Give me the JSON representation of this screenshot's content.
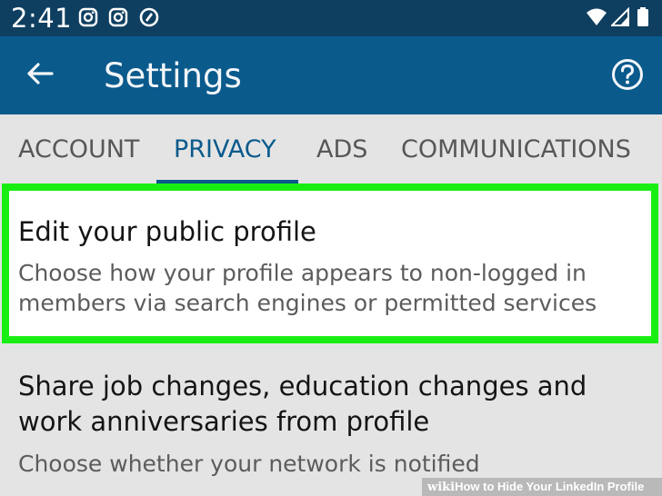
{
  "status_bar": {
    "time": "2:41",
    "left_icons": [
      "instagram-icon",
      "instagram-icon",
      "at-sign-icon"
    ],
    "right_icons": [
      "wifi-icon",
      "signal-icon",
      "battery-icon"
    ]
  },
  "app_bar": {
    "title": "Settings",
    "back_icon": "arrow-left-icon",
    "help_icon": "help-circle-icon"
  },
  "tabs": [
    {
      "label": "ACCOUNT",
      "active": false
    },
    {
      "label": "PRIVACY",
      "active": true
    },
    {
      "label": "ADS",
      "active": false
    },
    {
      "label": "COMMUNICATIONS",
      "active": false
    }
  ],
  "settings_items": [
    {
      "title": "Edit your public profile",
      "subtitle_lines": [
        "Choose how your profile appears to non-logged in",
        "members via search engines or permitted services"
      ],
      "highlighted": true
    },
    {
      "title_lines": [
        "Share job changes, education changes and",
        "work anniversaries from profile"
      ],
      "subtitle": "Choose whether your network is notified",
      "highlighted": false
    }
  ],
  "watermark": {
    "brand": "wiki",
    "text": "How to Hide Your LinkedIn Profile"
  },
  "colors": {
    "status_bar_bg": "#0f3f60",
    "app_bar_bg": "#0a5a8c",
    "accent": "#0a5a8c",
    "highlight_border": "#19ee13",
    "background": "#e4e4e4"
  }
}
